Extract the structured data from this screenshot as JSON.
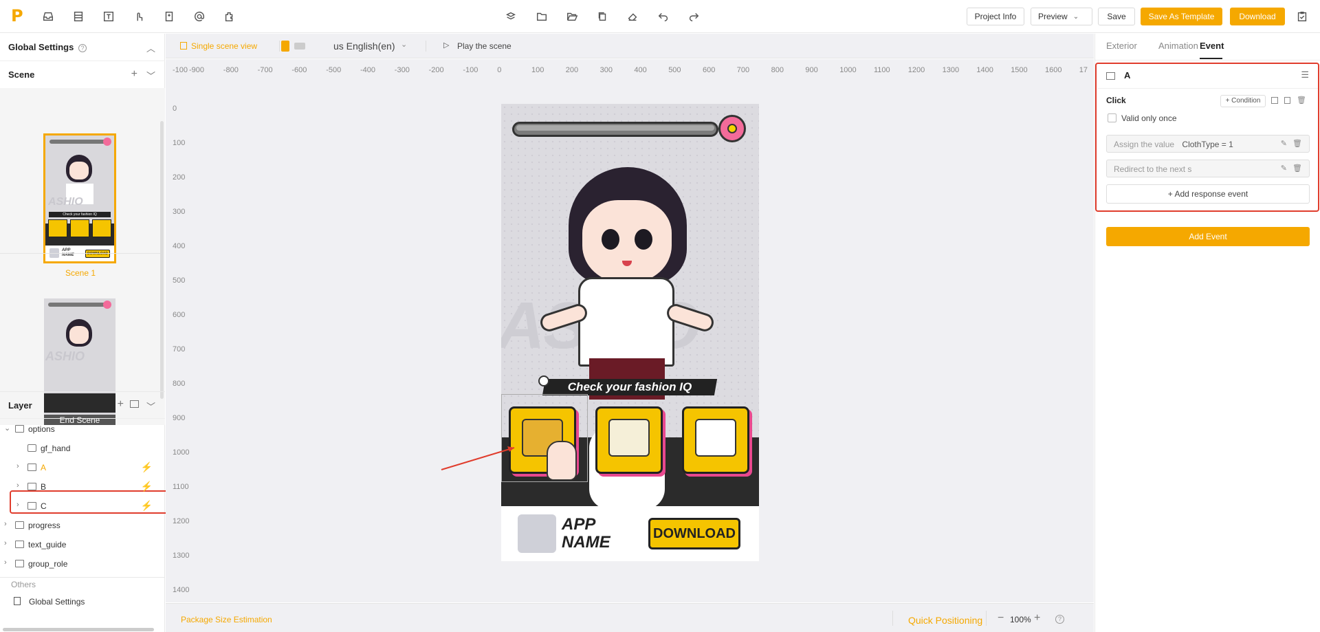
{
  "toolbar": {
    "project_info": "Project Info",
    "preview": "Preview",
    "save": "Save",
    "save_template": "Save As Template",
    "download": "Download",
    "brand_color": "#f5a800"
  },
  "left": {
    "global_settings": "Global Settings",
    "scene_title": "Scene",
    "scene1_label": "Scene 1",
    "end_scene_label": "End Scene",
    "thumb_check": "Check your fashion IQ",
    "thumb_app": "APP NAME",
    "thumb_download": "DOWNLOAD",
    "thumb_ashio": "ASHIO",
    "layer_title": "Layer",
    "layers": [
      {
        "label": "options"
      },
      {
        "label": "gf_hand"
      },
      {
        "label": "A"
      },
      {
        "label": "B"
      },
      {
        "label": "C"
      },
      {
        "label": "progress"
      },
      {
        "label": "text_guide"
      },
      {
        "label": "group_role"
      }
    ],
    "others_title": "Others",
    "others_item": "Global Settings"
  },
  "canvas": {
    "view_mode": "Single scene view",
    "language": "us English(en)",
    "play": "Play the scene",
    "ruler_x": [
      "-100",
      "-900",
      "-800",
      "-700",
      "-600",
      "-500",
      "-400",
      "-300",
      "-200",
      "-100",
      "0",
      "100",
      "200",
      "300",
      "400",
      "500",
      "600",
      "700",
      "800",
      "900",
      "1000",
      "1100",
      "1200",
      "1300",
      "1400",
      "1500",
      "1600",
      "17"
    ],
    "ruler_y": [
      "0",
      "100",
      "200",
      "300",
      "400",
      "500",
      "600",
      "700",
      "800",
      "900",
      "1000",
      "1100",
      "1200",
      "1300",
      "1400"
    ],
    "package": "Package Size Estimation",
    "quick": "Quick Positioning",
    "zoom": "100%"
  },
  "phone": {
    "check": "Check your fashion IQ",
    "app_line1": "APP",
    "app_line2": "NAME",
    "download": "DOWNLOAD",
    "bg_text": "ASHIO"
  },
  "right": {
    "tabs": [
      "Exterior",
      "Animation",
      "Event"
    ],
    "layer_name": "A",
    "event_type": "Click",
    "condition": "+ Condition",
    "valid_once": "Valid only once",
    "assign_label": "Assign the value",
    "assign_value": "ClothType = 1",
    "redirect": "Redirect to the next s",
    "add_response": "+ Add response event",
    "add_event": "Add Event"
  }
}
